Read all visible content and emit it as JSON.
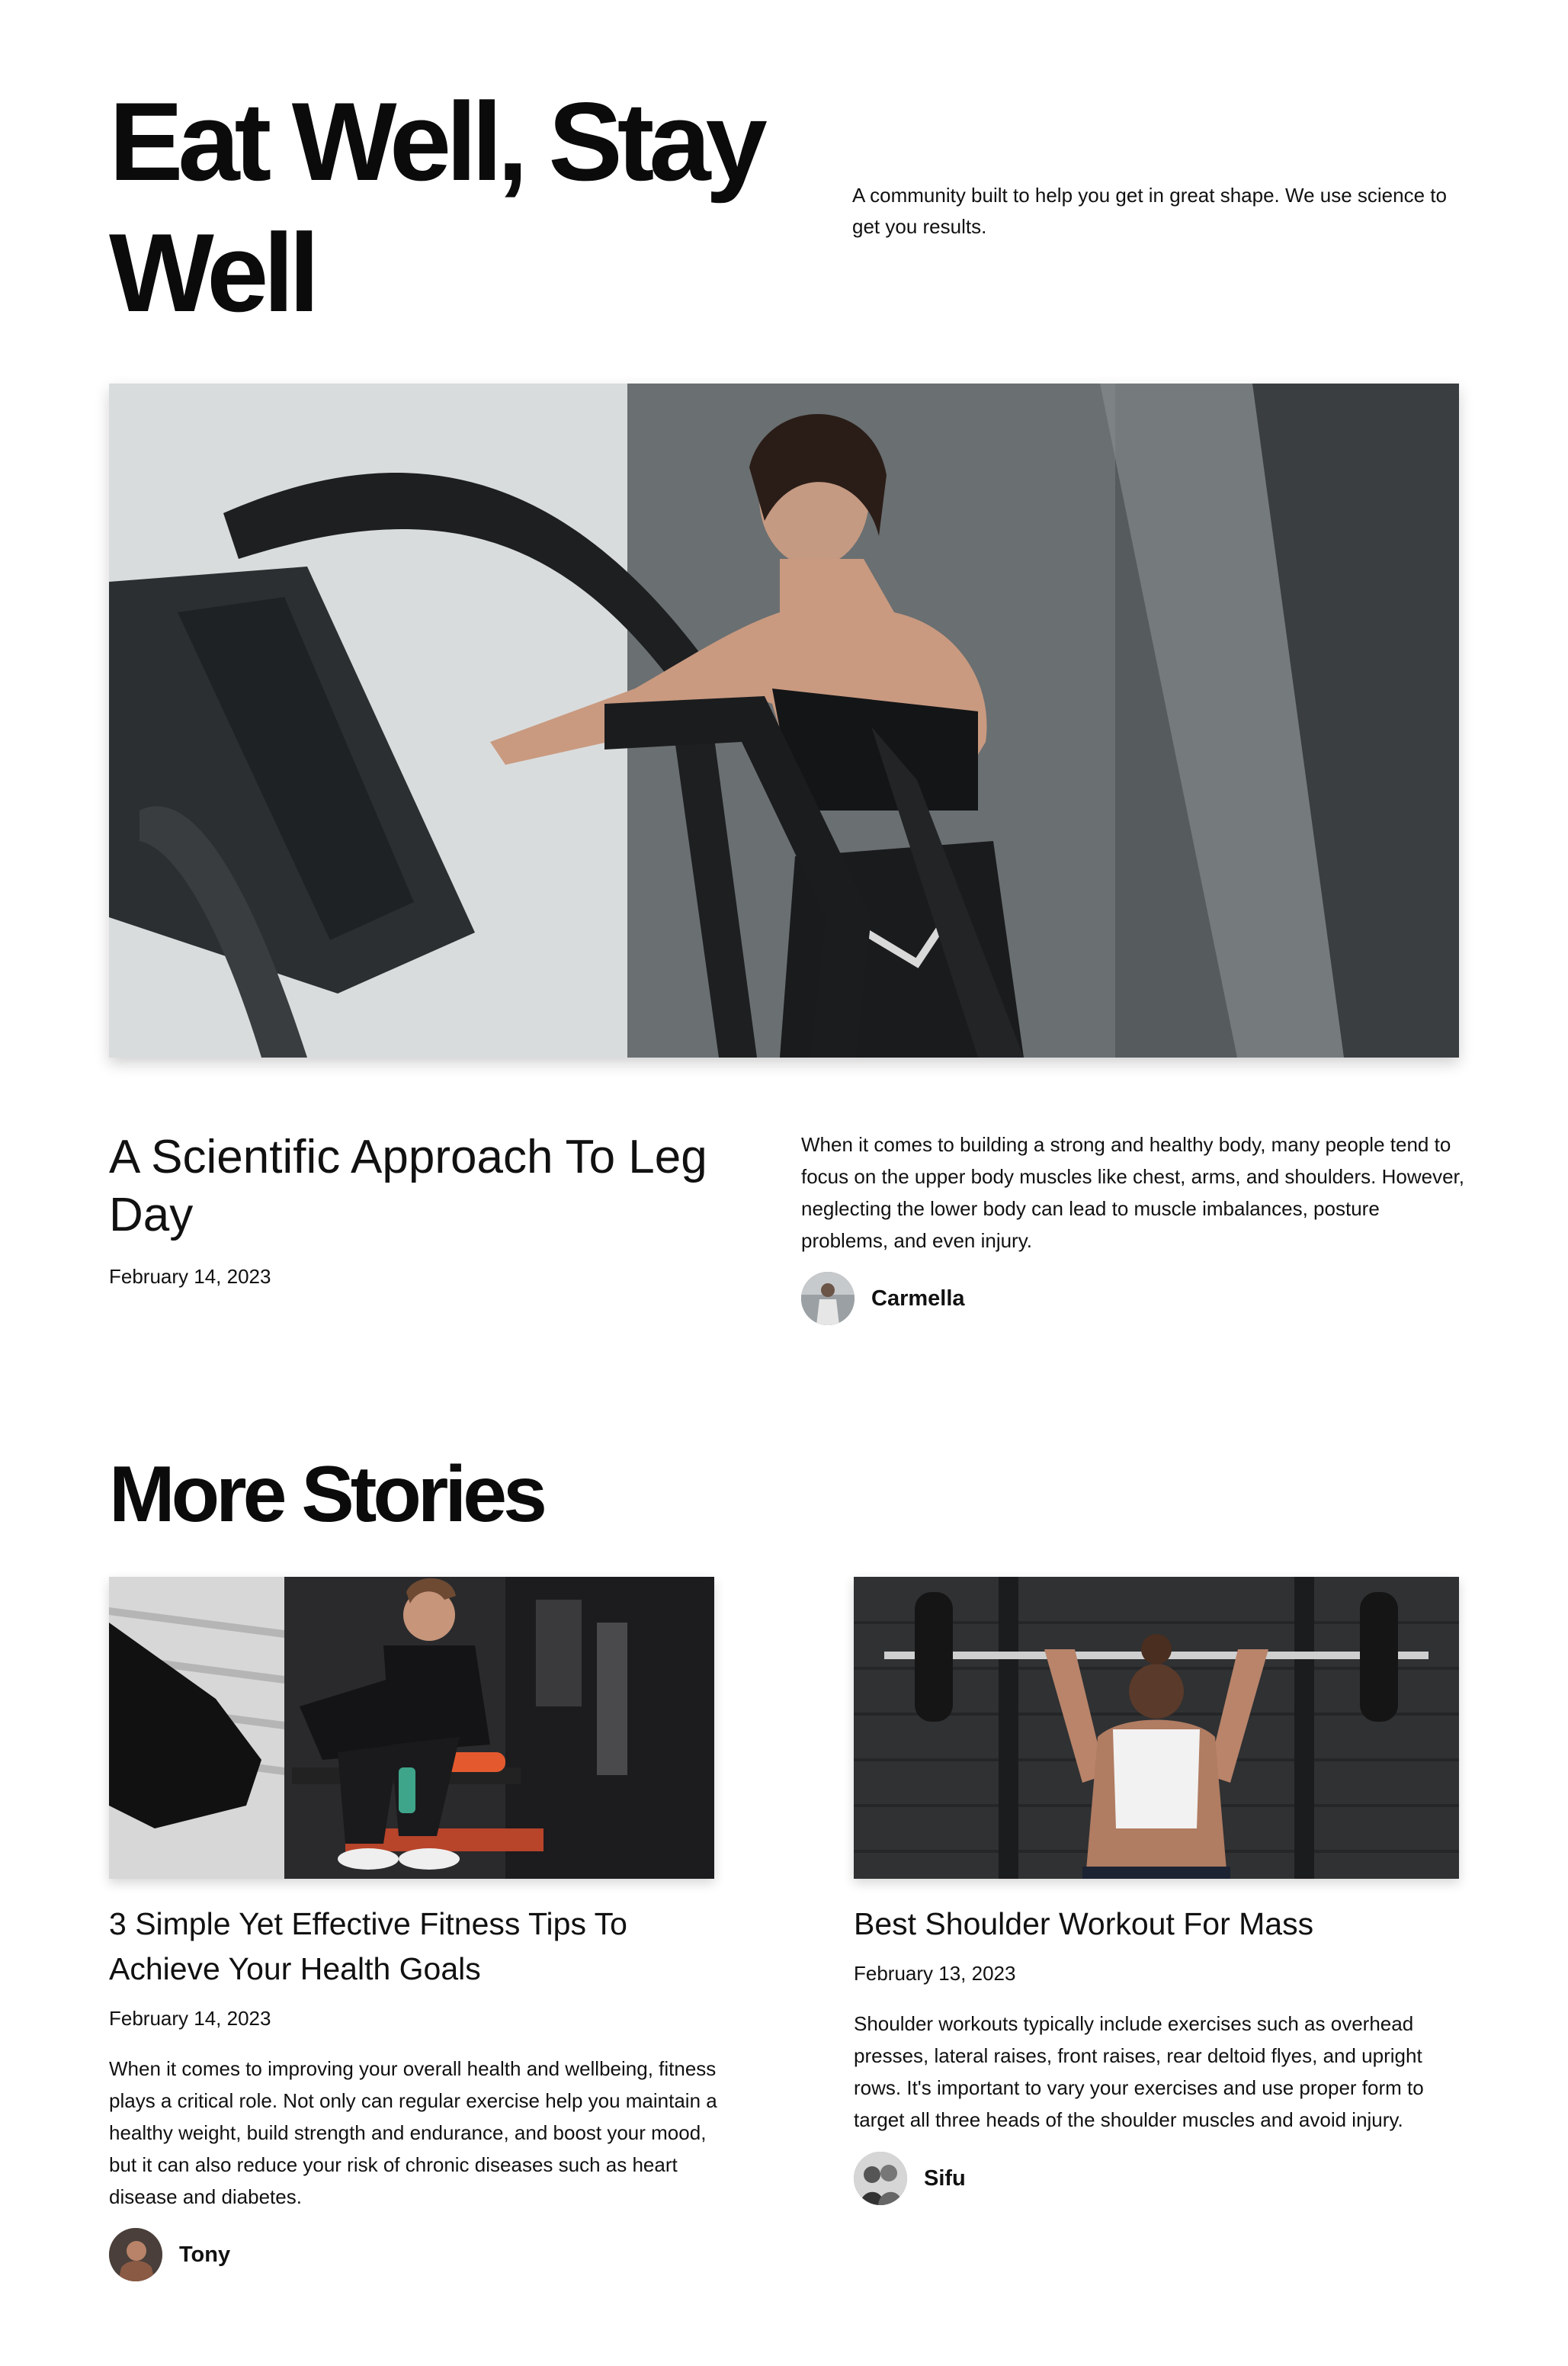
{
  "hero": {
    "title": "Eat Well, Stay Well",
    "tagline": "A community built to help you get in great shape. We use science to get you results."
  },
  "featured": {
    "image_icon": "photo-woman-on-elliptical-machine",
    "title": "A Scientific Approach To Leg Day",
    "date": "February 14, 2023",
    "excerpt": "When it comes to building a strong and healthy body, many people tend to focus on the upper body muscles like chest, arms, and shoulders. However, neglecting the lower body can lead to muscle imbalances, posture problems, and even injury.",
    "author": "Carmella"
  },
  "more_stories": {
    "heading": "More Stories",
    "stories": [
      {
        "image_icon": "photo-man-sitting-on-gym-bench",
        "title": "3 Simple Yet Effective Fitness Tips To Achieve Your Health Goals",
        "date": "February 14, 2023",
        "excerpt": "When it comes to improving your overall health and wellbeing, fitness plays a critical role. Not only can regular exercise help you maintain a healthy weight, build strength and endurance, and boost your mood, but it can also reduce your risk of chronic diseases such as heart disease and diabetes.",
        "author": "Tony"
      },
      {
        "image_icon": "photo-woman-overhead-barbell-press",
        "title": "Best Shoulder Workout For Mass",
        "date": "February 13, 2023",
        "excerpt": "Shoulder workouts typically include exercises such as overhead presses, lateral raises, front raises, rear deltoid flyes, and upright rows. It's important to vary your exercises and use proper form to target all three heads of the shoulder muscles and avoid injury.",
        "author": "Sifu"
      }
    ]
  },
  "colors": {
    "text": "#111111",
    "background": "#ffffff"
  }
}
